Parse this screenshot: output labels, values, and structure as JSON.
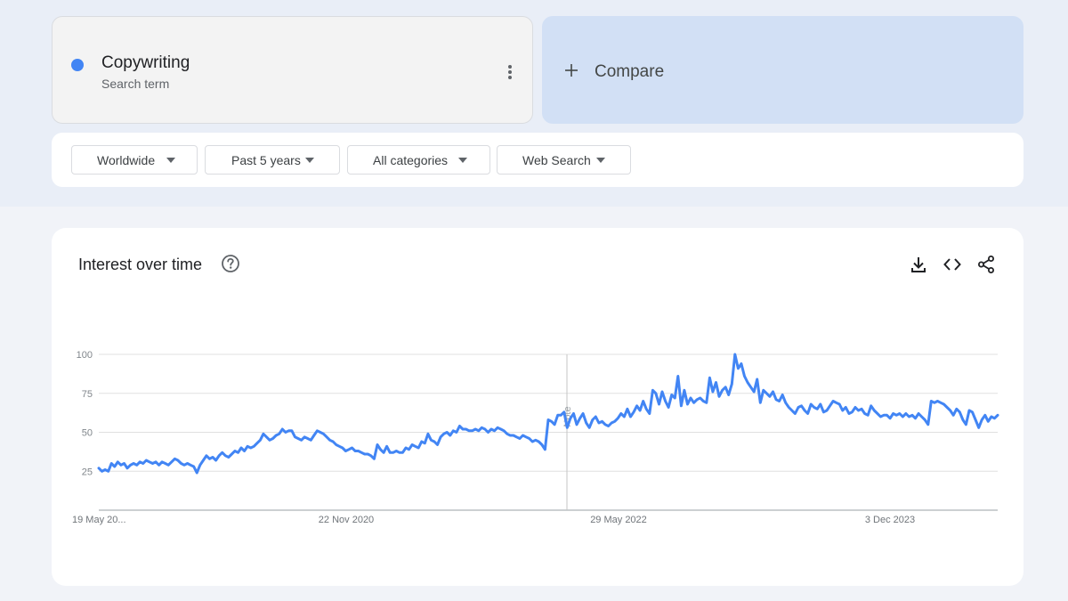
{
  "search_term": {
    "name": "Copywriting",
    "subtitle": "Search term",
    "color": "#4285f4"
  },
  "compare": {
    "label": "Compare"
  },
  "filters": [
    {
      "label": "Worldwide"
    },
    {
      "label": "Past 5 years"
    },
    {
      "label": "All categories"
    },
    {
      "label": "Web Search"
    }
  ],
  "chart_card": {
    "title": "Interest over time",
    "icons": [
      "help-icon",
      "download-icon",
      "embed-code-icon",
      "share-icon"
    ]
  },
  "chart_data": {
    "type": "line",
    "title": "Interest over time",
    "xlabel": "",
    "ylabel": "",
    "ylim": [
      0,
      100
    ],
    "y_ticks": [
      25,
      50,
      75,
      100
    ],
    "x_tick_labels": [
      "19 May 20...",
      "22 Nov 2020",
      "29 May 2022",
      "3 Dec 2023"
    ],
    "annotation": "Note",
    "grid": true,
    "series": [
      {
        "color": "#4285f4",
        "values": [
          27,
          25,
          26,
          25,
          30,
          28,
          31,
          29,
          30,
          27,
          29,
          30,
          29,
          31,
          30,
          32,
          31,
          30,
          31,
          29,
          31,
          30,
          29,
          31,
          33,
          32,
          30,
          29,
          30,
          29,
          28,
          24,
          29,
          32,
          35,
          33,
          34,
          32,
          35,
          37,
          35,
          34,
          36,
          38,
          37,
          40,
          38,
          41,
          40,
          41,
          43,
          45,
          49,
          47,
          45,
          46,
          48,
          49,
          52,
          50,
          51,
          51,
          47,
          46,
          45,
          47,
          46,
          45,
          48,
          51,
          50,
          49,
          47,
          45,
          44,
          42,
          41,
          40,
          38,
          39,
          40,
          38,
          38,
          37,
          36,
          36,
          35,
          33,
          42,
          39,
          37,
          41,
          37,
          37,
          38,
          37,
          37,
          40,
          39,
          42,
          41,
          40,
          44,
          43,
          49,
          45,
          44,
          42,
          47,
          49,
          50,
          48,
          51,
          50,
          54,
          52,
          52,
          51,
          51,
          52,
          51,
          53,
          52,
          50,
          52,
          51,
          53,
          52,
          51,
          49,
          48,
          48,
          47,
          46,
          48,
          47,
          46,
          44,
          45,
          44,
          42,
          39,
          58,
          57,
          55,
          61,
          61,
          63,
          53,
          59,
          62,
          55,
          59,
          62,
          56,
          53,
          58,
          60,
          56,
          57,
          55,
          54,
          56,
          57,
          59,
          62,
          60,
          65,
          60,
          63,
          67,
          64,
          70,
          65,
          62,
          77,
          75,
          68,
          76,
          70,
          66,
          74,
          72,
          86,
          67,
          77,
          68,
          72,
          69,
          71,
          72,
          70,
          69,
          85,
          76,
          82,
          73,
          77,
          79,
          74,
          81,
          100,
          91,
          94,
          86,
          82,
          79,
          76,
          84,
          69,
          77,
          75,
          73,
          76,
          71,
          70,
          74,
          69,
          66,
          64,
          62,
          66,
          67,
          64,
          62,
          68,
          66,
          65,
          68,
          63,
          64,
          67,
          70,
          69,
          68,
          64,
          66,
          62,
          63,
          66,
          64,
          65,
          62,
          61,
          67,
          64,
          62,
          60,
          61,
          61,
          59,
          62,
          61,
          62,
          60,
          62,
          60,
          61,
          59,
          62,
          60,
          58,
          55,
          70,
          69,
          70,
          69,
          68,
          66,
          64,
          61,
          65,
          63,
          58,
          55,
          64,
          63,
          58,
          53,
          58,
          61,
          57,
          60,
          59,
          61
        ]
      }
    ]
  }
}
